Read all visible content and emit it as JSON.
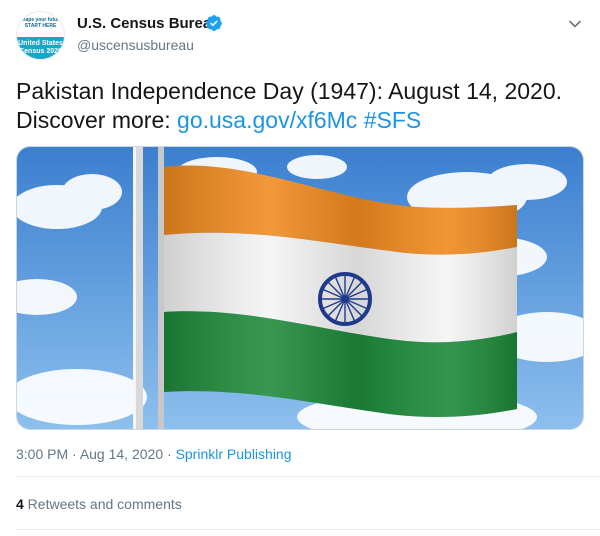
{
  "author": {
    "display_name": "U.S. Census Bureau",
    "handle": "@uscensusbureau",
    "verified": true,
    "avatar_text_top": "Shape your future START HERE",
    "avatar_text_bottom": "United States Census 2020"
  },
  "tweet": {
    "text_prefix": "Pakistan Independence Day (1947): August 14, 2020. Discover more: ",
    "link": "go.usa.gov/xf6Mc",
    "hashtag": "#SFS",
    "media_icon": "flag-photo"
  },
  "meta": {
    "time": "3:00 PM",
    "separator_1": " · ",
    "date": "Aug 14, 2020",
    "separator_2": " · ",
    "source": "Sprinklr Publishing"
  },
  "stats": {
    "retweets_count": "4",
    "retweets_label": " Retweets and comments"
  },
  "colors": {
    "link": "#1b95e0",
    "verified": "#1da1f2",
    "flag_saffron": "#ef8a1f",
    "flag_green": "#1d8a3a",
    "flag_chakra": "#1f3a8a"
  }
}
